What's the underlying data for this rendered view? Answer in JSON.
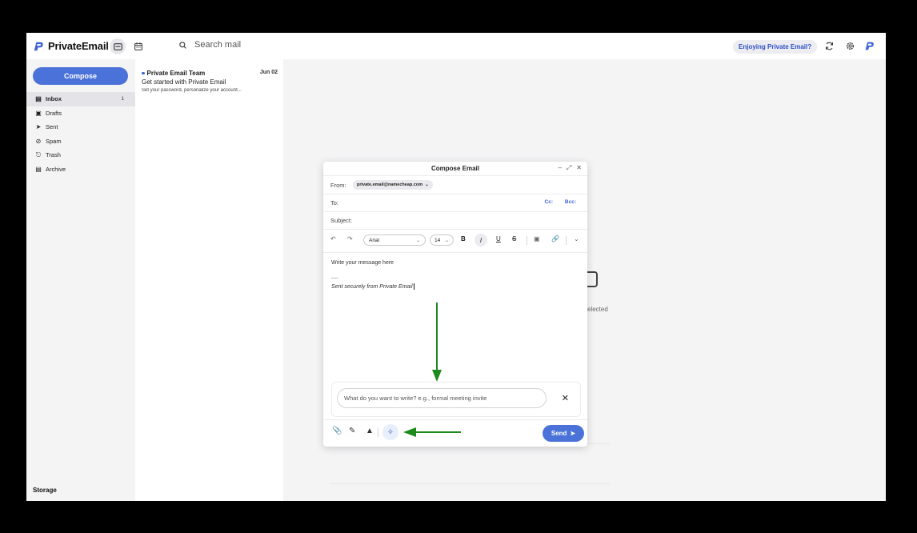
{
  "app": {
    "name": "PrivateEmail"
  },
  "topbar": {
    "search_placeholder": "Search mail",
    "enjoying_label": "Enjoying Private Email?"
  },
  "sidebar": {
    "compose_label": "Compose",
    "items": [
      {
        "label": "Inbox",
        "icon": "inbox-icon",
        "count": "1",
        "active": true
      },
      {
        "label": "Drafts",
        "icon": "drafts-icon"
      },
      {
        "label": "Sent",
        "icon": "sent-icon"
      },
      {
        "label": "Spam",
        "icon": "spam-icon"
      },
      {
        "label": "Trash",
        "icon": "trash-icon"
      },
      {
        "label": "Archive",
        "icon": "archive-icon"
      }
    ],
    "storage_label": "Storage"
  },
  "messages": [
    {
      "sender": "Private Email Team",
      "date": "Jun 02",
      "subject": "Get started with Private Email",
      "preview": "Set your password, personalize your account...",
      "unread": true
    }
  ],
  "reading_pane": {
    "empty_text": "elected"
  },
  "compose": {
    "title": "Compose Email",
    "from_label": "From:",
    "from_value": "private.email@namecheap.com",
    "to_label": "To:",
    "cc_label": "Cc:",
    "bcc_label": "Bcc:",
    "subject_label": "Subject:",
    "font_value": "Arial",
    "size_value": "14",
    "body_placeholder": "Write your message here",
    "signature_separator": "----",
    "signature": "Sent securely from Private Email",
    "ai_placeholder": "What do you want to write? e.g., formal meeting invite",
    "send_label": "Send"
  },
  "colors": {
    "accent": "#4a72d8",
    "annotation": "#1e8a1e",
    "sidebar_bg": "#f4f4f5"
  }
}
